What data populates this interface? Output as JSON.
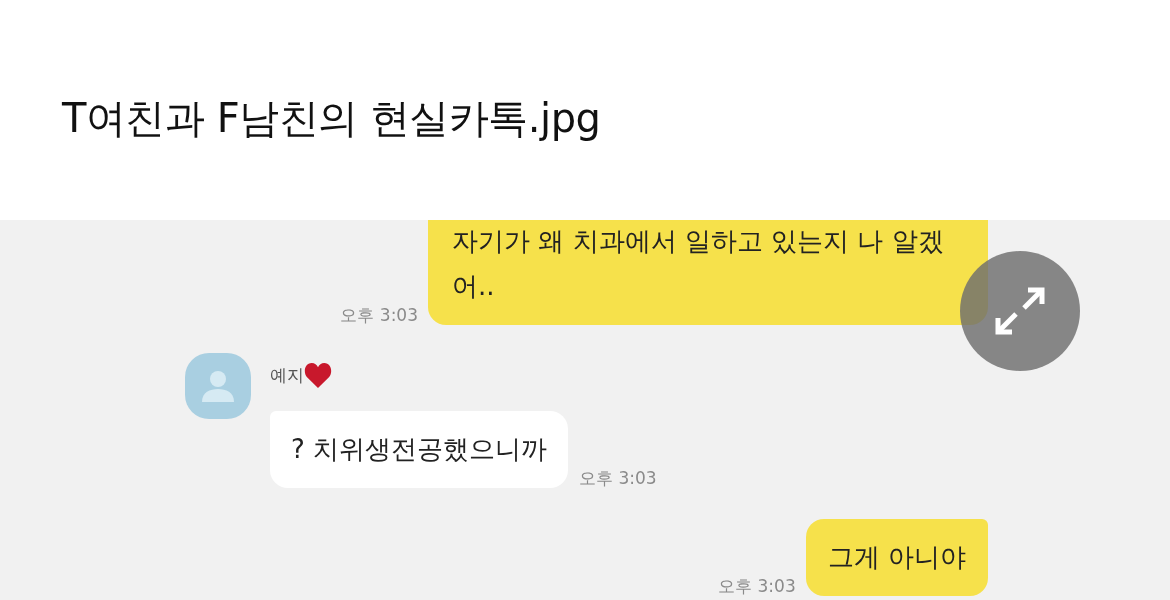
{
  "title": "T여친과 F남친의 현실카톡.jpg",
  "chat": {
    "messages": [
      {
        "kind": "sent",
        "text": "자기가 왜 치과에서 일하고 있는지 나 알겠어..",
        "time": "오후 3:03"
      },
      {
        "kind": "received",
        "sender": "예지",
        "text": "? 치위생전공했으니까",
        "time": "오후 3:03"
      },
      {
        "kind": "sent",
        "text": "그게 아니야",
        "time": "오후 3:03"
      }
    ]
  }
}
